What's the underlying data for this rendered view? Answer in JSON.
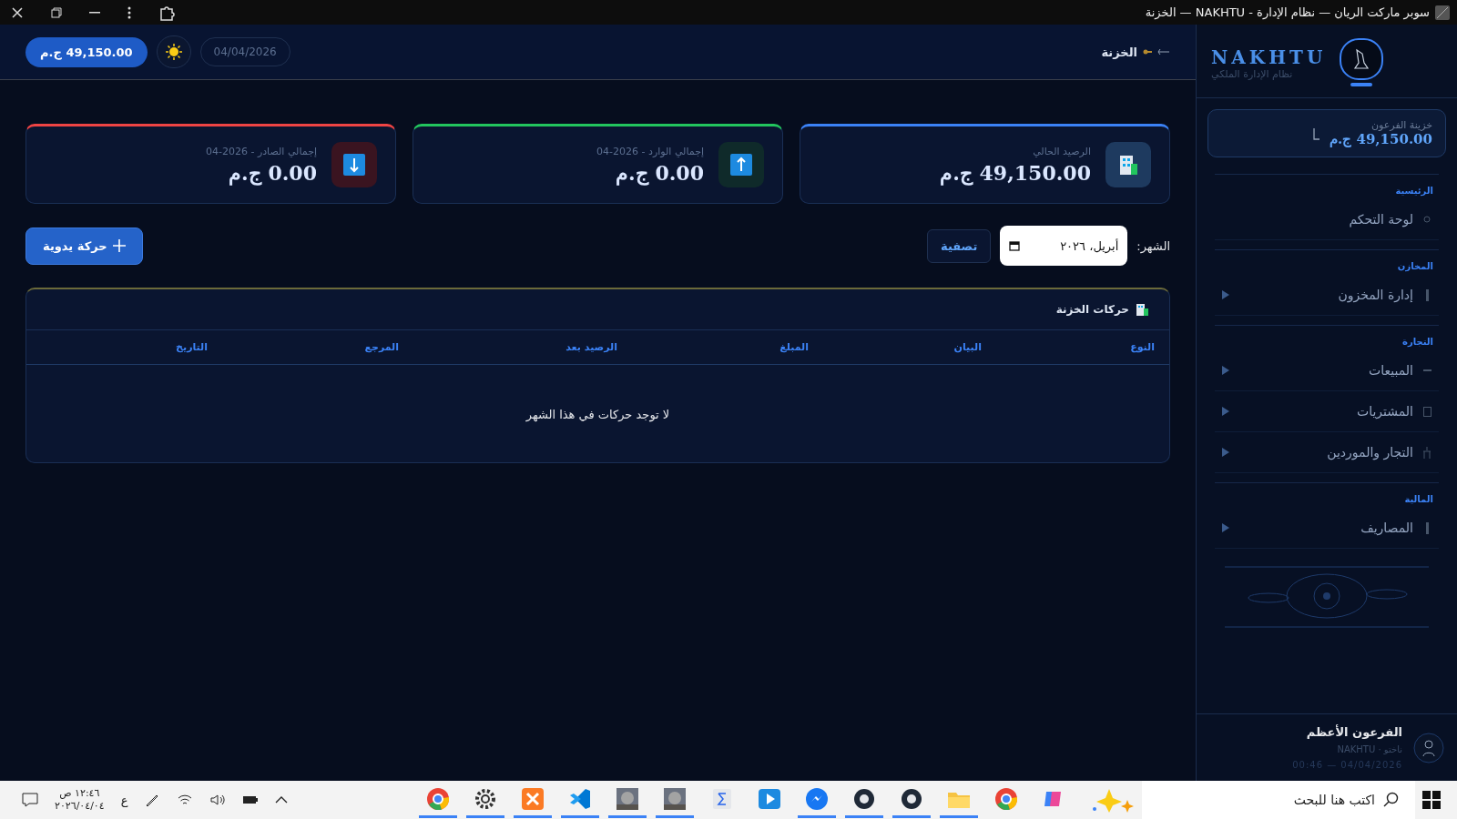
{
  "window": {
    "title": "سوبر ماركت الريان — نظام الإدارة - NAKHTU — الخزنة"
  },
  "header": {
    "page_title": "الخزنة",
    "date": "04/04/2026",
    "balance": "49,150.00 ج.م"
  },
  "sidebar": {
    "brand": "NAKHTU",
    "tagline": "نظام الإدارة الملكي",
    "treasury": {
      "label": "خزينة الفرعون",
      "amount": "49,150.00 ج.م"
    },
    "sections": [
      {
        "title": "الرئيسية",
        "items": [
          {
            "label": "لوحة التحكم",
            "kind": "dot",
            "expandable": false
          }
        ]
      },
      {
        "title": "المخازن",
        "items": [
          {
            "label": "إدارة المخزون",
            "kind": "bar",
            "expandable": true
          }
        ]
      },
      {
        "title": "التجارة",
        "items": [
          {
            "label": "المبيعات",
            "kind": "dash",
            "expandable": true
          },
          {
            "label": "المشتريات",
            "kind": "square",
            "expandable": true
          },
          {
            "label": "التجار والموردين",
            "kind": "figure",
            "expandable": true
          }
        ]
      },
      {
        "title": "المالية",
        "items": [
          {
            "label": "المصاريف",
            "kind": "bar",
            "expandable": true
          }
        ]
      }
    ],
    "user": {
      "name": "الفرعون الأعظم",
      "subtitle": "ناختو · NAKHTU",
      "datetime": "04/04/2026 — 00:46"
    }
  },
  "stats": [
    {
      "kind": "balance",
      "label": "الرصيد الحالي",
      "value": "49,150.00 ج.م",
      "color": "#3b82f6"
    },
    {
      "kind": "in",
      "label": "إجمالي الوارد - 2026-04",
      "value": "0.00 ج.م",
      "color": "#22c55e"
    },
    {
      "kind": "out",
      "label": "إجمالي الصادر - 2026-04",
      "value": "0.00 ج.م",
      "color": "#ef4444"
    }
  ],
  "filter": {
    "label": "الشهر:",
    "month": "أبريل، ٢٠٢٦",
    "button": "تصفية"
  },
  "add_button": "حركة يدوية",
  "table": {
    "title": "حركات الخزنة",
    "columns": [
      "النوع",
      "البيان",
      "المبلغ",
      "الرصيد بعد",
      "المرجع",
      "التاريخ"
    ],
    "empty": "لا توجد حركات في هذا الشهر"
  },
  "taskbar": {
    "search_placeholder": "اكتب هنا للبحث",
    "language": "ع",
    "time": "١٢:٤٦ ص",
    "date": "٢٠٢٦/٠٤/٠٤",
    "apps": [
      {
        "kind": "chrome",
        "running": true
      },
      {
        "kind": "gear",
        "running": true
      },
      {
        "kind": "xampp",
        "running": true
      },
      {
        "kind": "code",
        "running": true
      },
      {
        "kind": "photo",
        "running": true
      },
      {
        "kind": "photo",
        "running": true
      },
      {
        "kind": "sigma",
        "running": false
      },
      {
        "kind": "play",
        "running": false
      },
      {
        "kind": "messenger",
        "running": true
      },
      {
        "kind": "circle",
        "running": true
      },
      {
        "kind": "circle",
        "running": true
      },
      {
        "kind": "folder",
        "running": true
      },
      {
        "kind": "chrome",
        "running": false
      },
      {
        "kind": "copilot",
        "running": false
      }
    ]
  }
}
